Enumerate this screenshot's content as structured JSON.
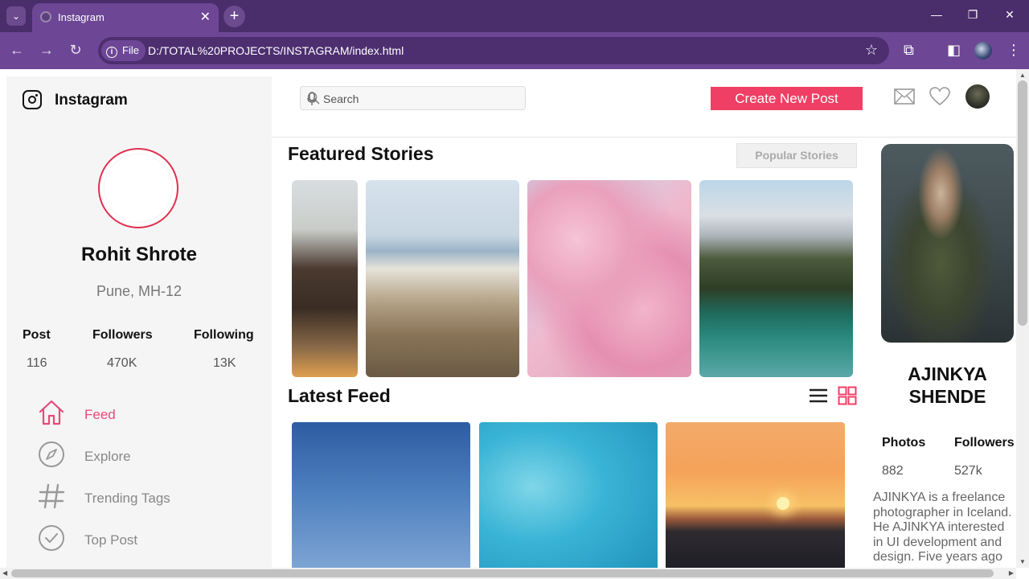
{
  "browser": {
    "tab_title": "Instagram",
    "address_prefix": "File",
    "url": "D:/TOTAL%20PROJECTS/INSTAGRAM/index.html"
  },
  "sidebar": {
    "brand": "Instagram",
    "profile_name": "Rohit Shrote",
    "location": "Pune, MH-12",
    "stats": [
      {
        "label": "Post",
        "value": "116"
      },
      {
        "label": "Followers",
        "value": "470K"
      },
      {
        "label": "Following",
        "value": "13K"
      }
    ],
    "nav": [
      {
        "label": "Feed",
        "icon": "home-icon",
        "active": true
      },
      {
        "label": "Explore",
        "icon": "compass-icon",
        "active": false
      },
      {
        "label": "Trending Tags",
        "icon": "hashtag-icon",
        "active": false
      },
      {
        "label": "Top Post",
        "icon": "check-circle-icon",
        "active": false
      }
    ]
  },
  "topbar": {
    "search_placeholder": "Search",
    "create_post_label": "Create New Post"
  },
  "featured": {
    "title": "Featured Stories",
    "popular_label": "Popular Stories"
  },
  "feed": {
    "title": "Latest Feed"
  },
  "right_panel": {
    "name": "AJINKYA SHENDE",
    "photos_label": "Photos",
    "photos_value": "882",
    "followers_label": "Followers",
    "followers_value": "527k",
    "bio": "AJINKYA is a freelance photographer in Iceland. He AJINKYA interested in UI development and design. Five years ago"
  },
  "colors": {
    "accent": "#ef3f64",
    "active_nav": "#e84a7a",
    "browser_frame": "#6d4796"
  }
}
